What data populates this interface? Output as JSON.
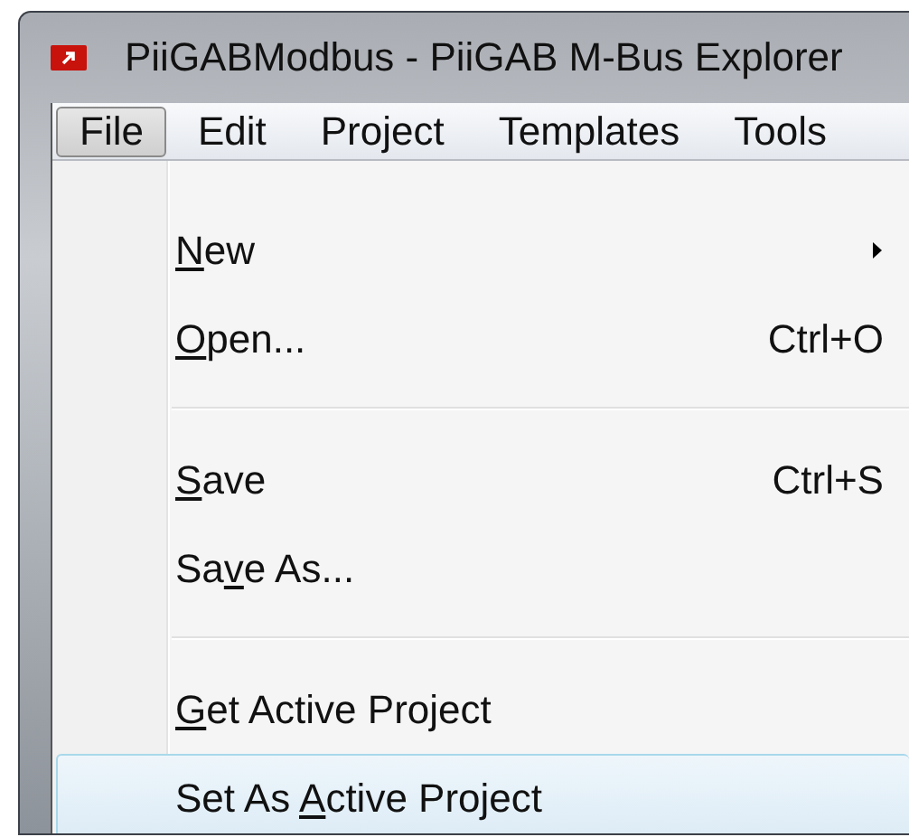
{
  "window": {
    "title": "PiiGABModbus - PiiGAB M-Bus Explorer"
  },
  "menu_bar": [
    {
      "label": "File",
      "selected": true
    },
    {
      "label": "Edit",
      "selected": false
    },
    {
      "label": "Project",
      "selected": false
    },
    {
      "label": "Templates",
      "selected": false
    },
    {
      "label": "Tools",
      "selected": false
    }
  ],
  "file_menu": [
    {
      "kind": "item",
      "mnemonic": "N",
      "label_after": "ew",
      "submenu": true,
      "selected": false
    },
    {
      "kind": "item",
      "mnemonic": "O",
      "label_after": "pen...",
      "shortcut": "Ctrl+O",
      "selected": false
    },
    {
      "kind": "separator"
    },
    {
      "kind": "item",
      "mnemonic": "S",
      "label_after": "ave",
      "shortcut": "Ctrl+S",
      "selected": false
    },
    {
      "kind": "item",
      "label_before": "Sa",
      "mnemonic": "v",
      "label_after": "e As...",
      "selected": false
    },
    {
      "kind": "separator"
    },
    {
      "kind": "item",
      "mnemonic": "G",
      "label_after": "et Active Project",
      "selected": false
    },
    {
      "kind": "item",
      "label_before": "Set As ",
      "mnemonic": "A",
      "label_after": "ctive Project",
      "selected": true
    }
  ]
}
